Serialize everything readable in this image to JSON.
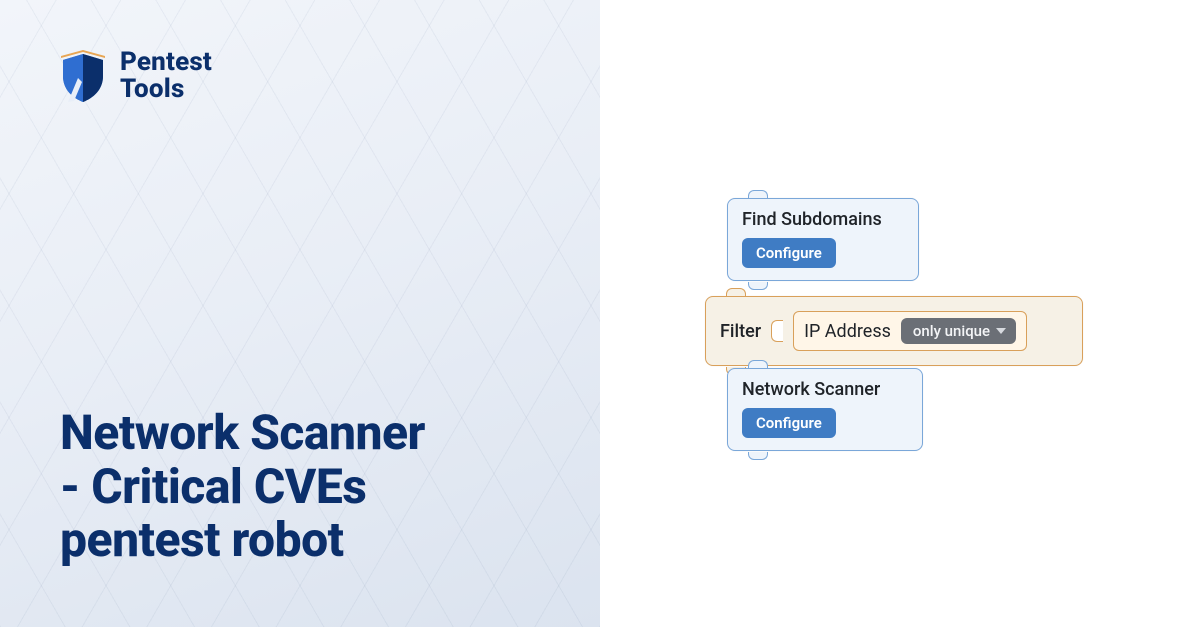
{
  "brand": {
    "name_line1": "Pentest",
    "name_line2": "Tools",
    "colors": {
      "primary": "#0b2f6b",
      "accent_orange": "#e39a3b",
      "block_blue": "#3f7cc4"
    }
  },
  "headline": {
    "line1": "Network Scanner",
    "line2": "- Critical CVEs",
    "line3": "pentest robot"
  },
  "blocks": {
    "find_subdomains": {
      "title": "Find Subdomains",
      "configure": "Configure"
    },
    "filter": {
      "label": "Filter",
      "ip_label": "IP Address",
      "chip": "only unique"
    },
    "network_scanner": {
      "title": "Network Scanner",
      "configure": "Configure"
    }
  }
}
